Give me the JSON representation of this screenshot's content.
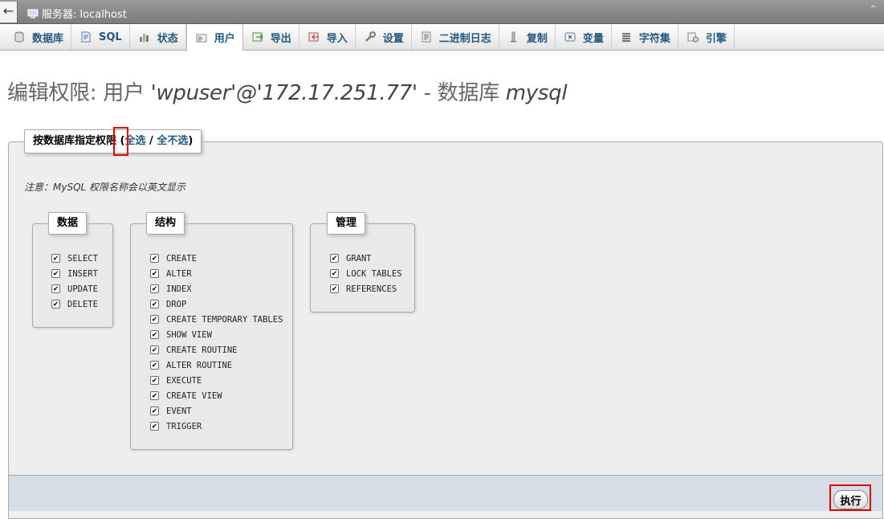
{
  "server_bar": {
    "label": "服务器: localhost"
  },
  "tabs": [
    {
      "label": "数据库",
      "icon": "database-icon"
    },
    {
      "label": "SQL",
      "icon": "sql-icon"
    },
    {
      "label": "状态",
      "icon": "status-icon"
    },
    {
      "label": "用户",
      "icon": "users-icon",
      "active": true
    },
    {
      "label": "导出",
      "icon": "export-icon"
    },
    {
      "label": "导入",
      "icon": "import-icon"
    },
    {
      "label": "设置",
      "icon": "settings-icon"
    },
    {
      "label": "二进制日志",
      "icon": "binlog-icon"
    },
    {
      "label": "复制",
      "icon": "replication-icon"
    },
    {
      "label": "变量",
      "icon": "variables-icon"
    },
    {
      "label": "字符集",
      "icon": "charset-icon"
    },
    {
      "label": "引擎",
      "icon": "engine-icon"
    }
  ],
  "title": {
    "prefix": "编辑权限: 用户 ",
    "user": "'wpuser'@'172.17.251.77'",
    "separator": " - 数据库 ",
    "database": "mysql"
  },
  "fieldset": {
    "legend": "按数据库指定权限",
    "open_paren": " (",
    "select_all": "全选",
    "divider": " / ",
    "select_none": "全不选",
    "close_paren": ")"
  },
  "note": "注意：MySQL 权限名称会以英文显示",
  "groups": {
    "data": {
      "legend": "数据",
      "items": [
        "SELECT",
        "INSERT",
        "UPDATE",
        "DELETE"
      ]
    },
    "structure": {
      "legend": "结构",
      "items": [
        "CREATE",
        "ALTER",
        "INDEX",
        "DROP",
        "CREATE TEMPORARY TABLES",
        "SHOW VIEW",
        "CREATE ROUTINE",
        "ALTER ROUTINE",
        "EXECUTE",
        "CREATE VIEW",
        "EVENT",
        "TRIGGER"
      ]
    },
    "admin": {
      "legend": "管理",
      "items": [
        "GRANT",
        "LOCK TABLES",
        "REFERENCES"
      ]
    }
  },
  "checkbox_mark": "✔",
  "footer": {
    "go_label": "执行"
  },
  "colors": {
    "link": "#235a81",
    "highlight": "#e00000",
    "footer": "#d5dee7"
  }
}
